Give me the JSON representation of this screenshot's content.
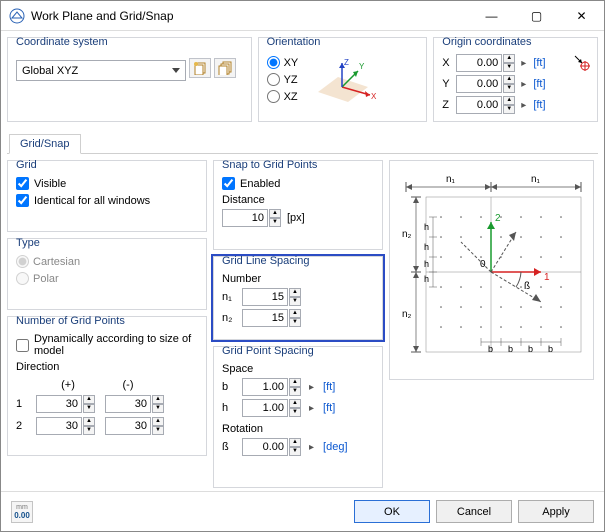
{
  "window": {
    "title": "Work Plane and Grid/Snap"
  },
  "title_controls": {
    "minimize": "—",
    "maximize": "▢",
    "close": "✕"
  },
  "coord": {
    "title": "Coordinate system",
    "value": "Global XYZ"
  },
  "orient": {
    "title": "Orientation",
    "xy": "XY",
    "yz": "YZ",
    "xz": "XZ",
    "selected": "XY"
  },
  "origin": {
    "title": "Origin coordinates",
    "axes": [
      "X",
      "Y",
      "Z"
    ],
    "values": [
      "0.00",
      "0.00",
      "0.00"
    ],
    "unit": "[ft]"
  },
  "tab": {
    "label": "Grid/Snap"
  },
  "grid": {
    "title": "Grid",
    "visible": "Visible",
    "identical": "Identical for all windows"
  },
  "type": {
    "title": "Type",
    "cartesian": "Cartesian",
    "polar": "Polar"
  },
  "numpoints": {
    "title": "Number of Grid Points",
    "dynamic": "Dynamically according to size of model",
    "direction": "Direction",
    "plus": "(+)",
    "minus": "(-)",
    "row1": "1",
    "row2": "2",
    "v": [
      "30",
      "30",
      "30",
      "30"
    ]
  },
  "snap": {
    "title": "Snap to Grid Points",
    "enabled": "Enabled",
    "distance": "Distance",
    "dist_val": "10",
    "dist_unit": "[px]"
  },
  "gls": {
    "title": "Grid Line Spacing",
    "number": "Number",
    "n1": "n₁",
    "n2": "n₂",
    "v1": "15",
    "v2": "15"
  },
  "gps": {
    "title": "Grid Point Spacing",
    "space": "Space",
    "b": "b",
    "h": "h",
    "bv": "1.00",
    "hv": "1.00",
    "unit_ft": "[ft]",
    "rotation": "Rotation",
    "beta": "ß",
    "betav": "0.00",
    "unit_deg": "[deg]"
  },
  "preview": {
    "n1": "n₁",
    "n1b": "n₁",
    "n2a": "n₂",
    "n2b": "n₂",
    "zero": "0",
    "axis1": "1",
    "axis2": "2",
    "b": "b",
    "h": "h",
    "beta": "ß"
  },
  "footer": {
    "status": "0.00",
    "ok": "OK",
    "cancel": "Cancel",
    "apply": "Apply"
  }
}
